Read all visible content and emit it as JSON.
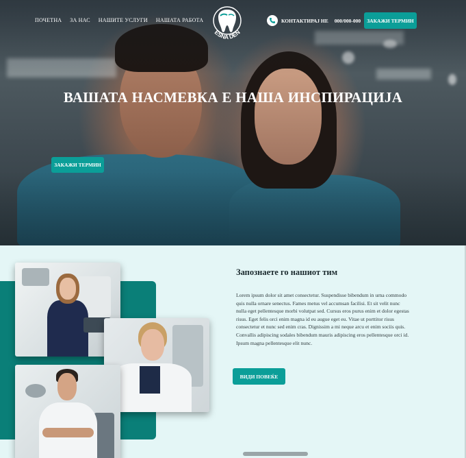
{
  "nav": {
    "items": [
      "ПОЧЕТНА",
      "ЗА НАС",
      "НАШИТЕ УСЛУГИ",
      "НАШАТА РАБОТА"
    ]
  },
  "logo": {
    "text": "VESNA DENT",
    "icon": "tooth-icon"
  },
  "contact": {
    "label": "КОНТАКТИРАЈ НЕ",
    "phone": "000/000-000",
    "icon": "phone-icon"
  },
  "header_button": "ЗАКАЖИ ТЕРМИН",
  "hero": {
    "title": "ВАШАТА НАСМЕВКА Е НАША ИНСПИРАЦИЈА",
    "button": "ЗАКАЖИ ТЕРМИН"
  },
  "team": {
    "title": "Запознаете го нашиот тим",
    "text": "Lorem ipsum dolor sit amet consectetur. Suspendisse bibendum in urna commodo quis nulla ornare senectus. Fames metus vel accumsan facilisi. Et sit velit nunc nulla eget pellentesque morbi volutpat sed. Cursus eros purus enim et dolor egestas risus. Eget felis orci enim magna id eu augue eget eu. Vitae ut porttitor risus consectetur et nunc sed enim cras. Dignissim a mi neque arcu et enim sociis quis. Convallis adipiscing sodales bibendum mauris adipiscing eros pellentesque orci id. Ipsum magna pellentesque elit nunc.",
    "button": "ВИДИ ПОВЕЌЕ"
  },
  "colors": {
    "accent": "#0b9e98",
    "teal_dark": "#0a7f78",
    "section_bg": "#e4f6f6"
  }
}
